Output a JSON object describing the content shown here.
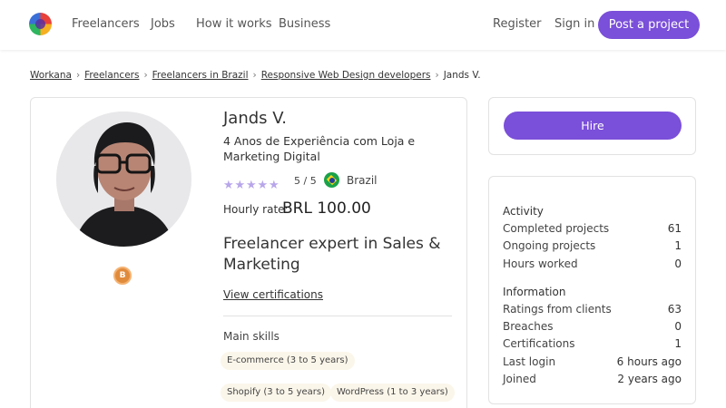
{
  "header": {
    "nav": [
      "Freelancers",
      "Jobs",
      "How it works",
      "Business"
    ],
    "register": "Register",
    "sign_in": "Sign in",
    "post_project": "Post a project"
  },
  "breadcrumb": [
    "Workana",
    "Freelancers",
    "Freelancers in Brazil",
    "Responsive Web Design developers",
    "Jands V."
  ],
  "profile": {
    "name": "Jands V.",
    "tagline": "4 Anos de Experiência com Loja e Marketing Digital",
    "rating_stars": 5,
    "rating_text": "5 / 5",
    "country": "Brazil",
    "hourly_label": "Hourly rate:",
    "hourly_value": "BRL 100.00",
    "headline": "Freelancer expert in Sales & Marketing",
    "view_certifications": "View certifications",
    "badge_letter": "B",
    "skills_label": "Main skills",
    "skills": [
      "E-commerce (3 to 5 years)",
      "Shopify (3 to 5 years)",
      "WordPress (1 to 3 years)"
    ]
  },
  "hire": {
    "label": "Hire"
  },
  "stats": {
    "activity_heading": "Activity",
    "activity": [
      {
        "label": "Completed projects",
        "value": "61"
      },
      {
        "label": "Ongoing projects",
        "value": "1"
      },
      {
        "label": "Hours worked",
        "value": "0"
      }
    ],
    "information_heading": "Information",
    "information": [
      {
        "label": "Ratings from clients",
        "value": "63"
      },
      {
        "label": "Breaches",
        "value": "0"
      },
      {
        "label": "Certifications",
        "value": "1"
      },
      {
        "label": "Last login",
        "value": "6 hours ago"
      },
      {
        "label": "Joined",
        "value": "2 years ago"
      }
    ]
  },
  "colors": {
    "accent": "#7a4fd9",
    "star": "#b8a6ea",
    "chip_bg": "#fbf6ea",
    "badge": "#e08a3c"
  }
}
